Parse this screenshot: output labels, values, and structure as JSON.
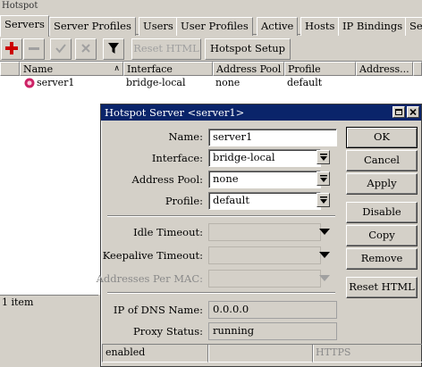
{
  "window": {
    "title": "Hotspot"
  },
  "tabs": [
    "Servers",
    "Server Profiles",
    "Users",
    "User Profiles",
    "Active",
    "Hosts",
    "IP Bindings",
    "Se"
  ],
  "toolbar": {
    "reset_html": "Reset HTML",
    "hotspot_setup": "Hotspot Setup"
  },
  "table": {
    "columns": [
      "Name",
      "Interface",
      "Address Pool",
      "Profile",
      "Address..."
    ],
    "rows": [
      {
        "name": "server1",
        "interface": "bridge-local",
        "address_pool": "none",
        "profile": "default"
      }
    ]
  },
  "status": {
    "count": "1 item"
  },
  "dialog": {
    "title": "Hotspot Server <server1>",
    "fields": {
      "name": {
        "label": "Name:",
        "value": "server1"
      },
      "interface": {
        "label": "Interface:",
        "value": "bridge-local"
      },
      "address_pool": {
        "label": "Address Pool:",
        "value": "none"
      },
      "profile": {
        "label": "Profile:",
        "value": "default"
      },
      "idle_timeout": {
        "label": "Idle Timeout:",
        "value": ""
      },
      "keepalive_timeout": {
        "label": "Keepalive Timeout:",
        "value": ""
      },
      "addresses_per_mac": {
        "label": "Addresses Per MAC:",
        "value": ""
      },
      "ip_of_dns_name": {
        "label": "IP of DNS Name:",
        "value": "0.0.0.0"
      },
      "proxy_status": {
        "label": "Proxy Status:",
        "value": "running"
      }
    },
    "buttons": {
      "ok": "OK",
      "cancel": "Cancel",
      "apply": "Apply",
      "disable": "Disable",
      "copy": "Copy",
      "remove": "Remove",
      "reset_html": "Reset HTML"
    },
    "status_left": "enabled",
    "status_right": "HTTPS"
  },
  "colors": {
    "face": "#d4d0c8",
    "titlebar": "#0a246a",
    "add_icon": "#cc0000"
  }
}
